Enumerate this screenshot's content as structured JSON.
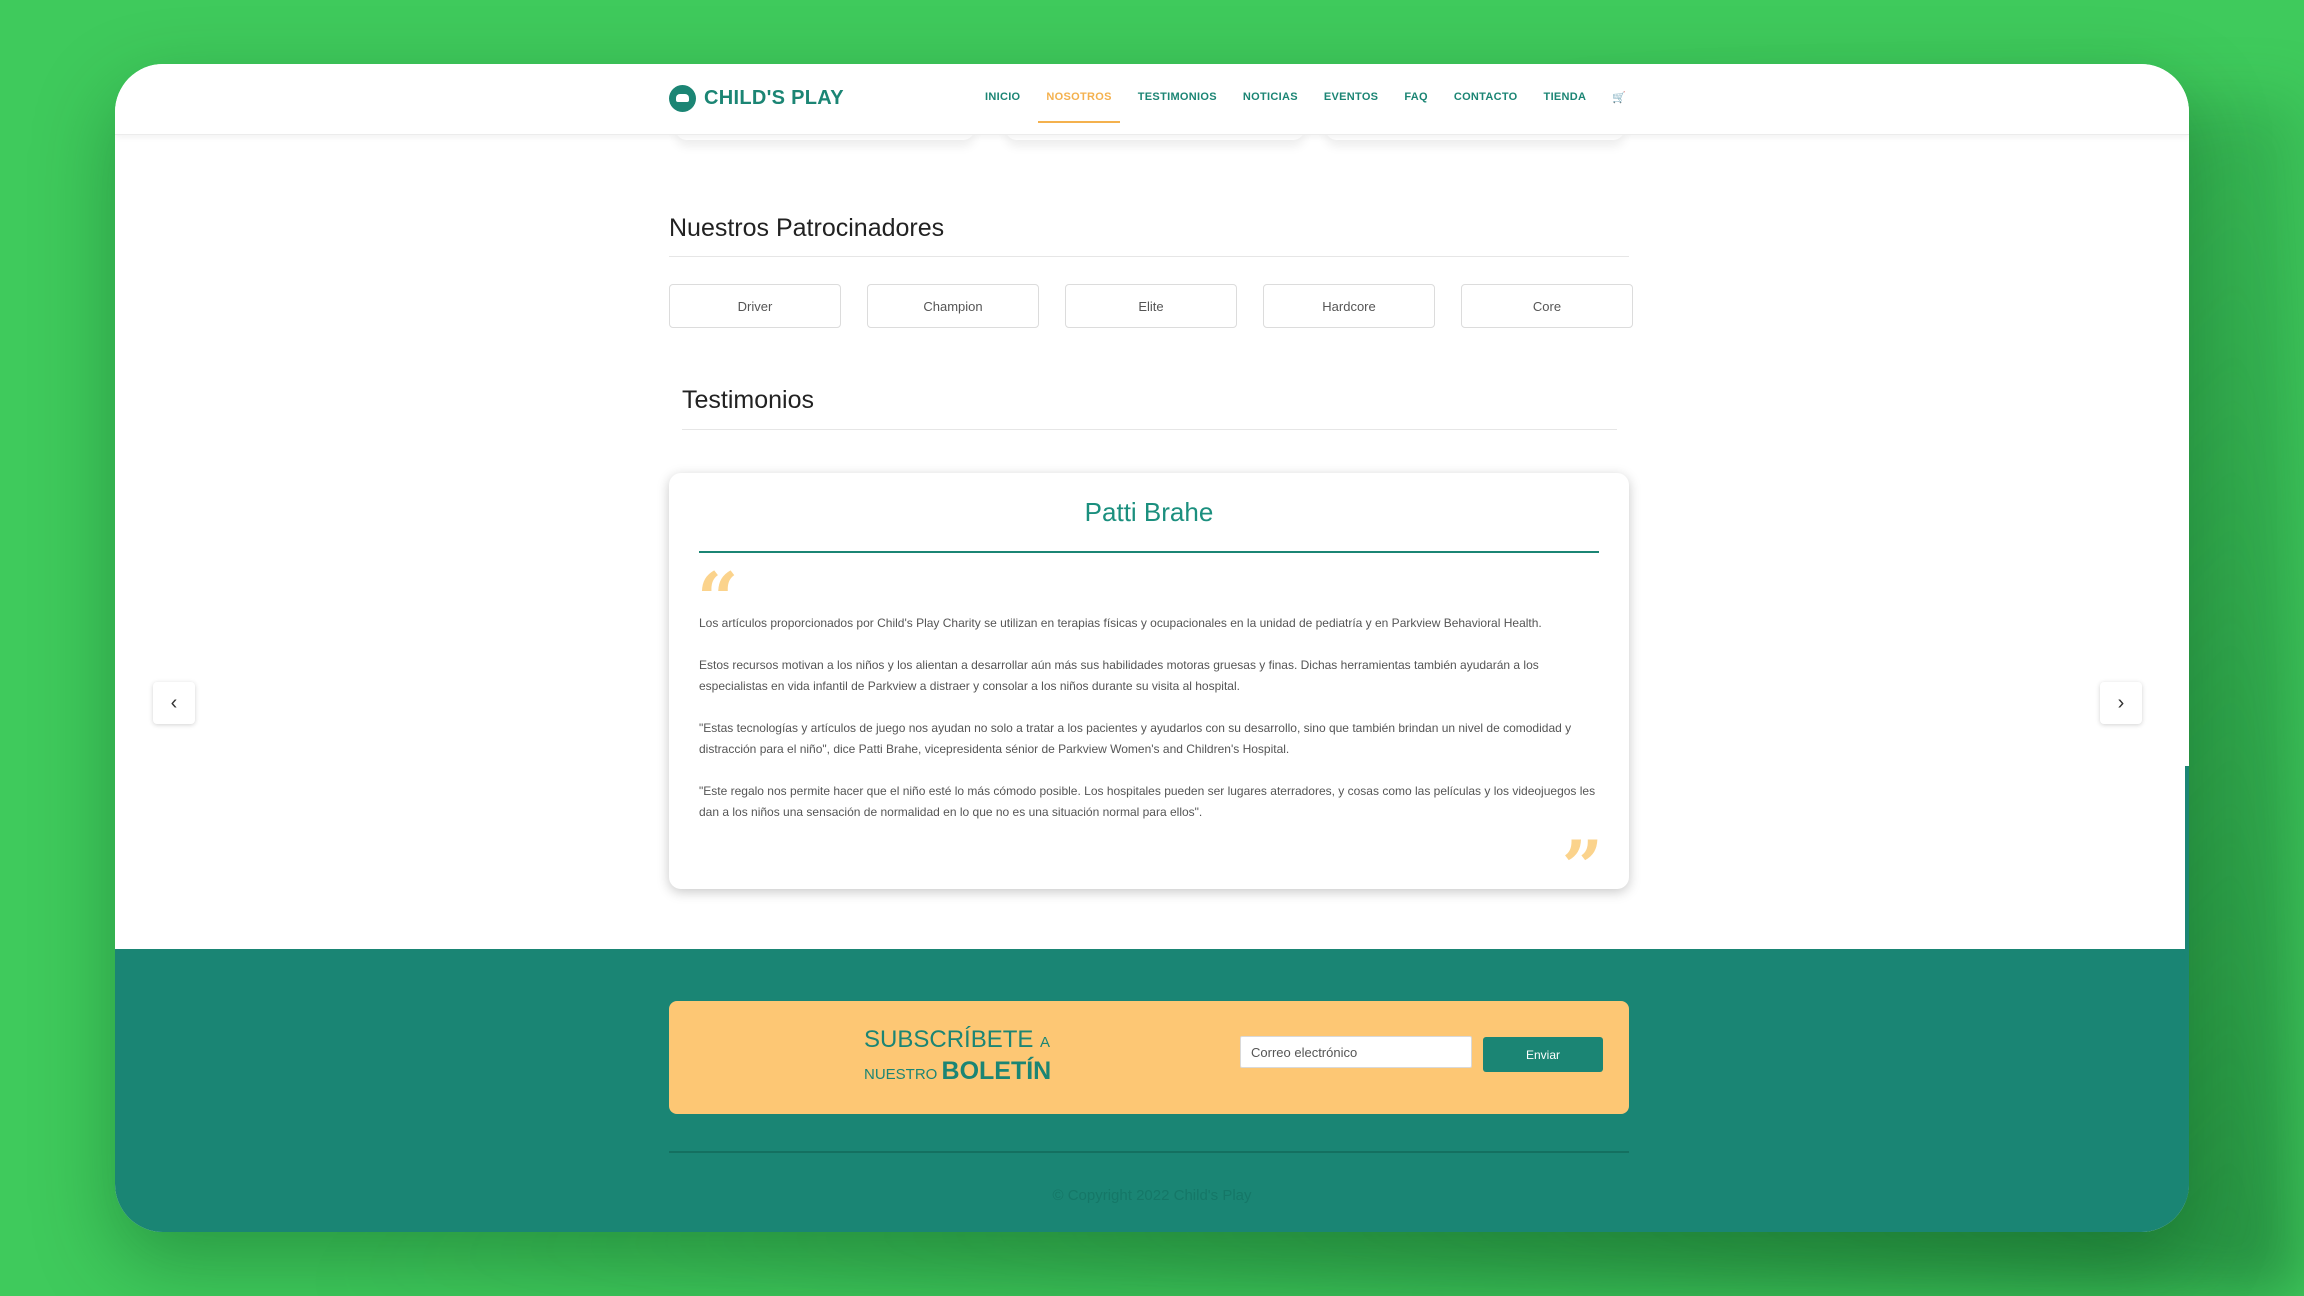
{
  "header": {
    "brand": "CHILD'S PLAY",
    "nav": [
      "INICIO",
      "NOSOTROS",
      "TESTIMONIOS",
      "NOTICIAS",
      "EVENTOS",
      "FAQ",
      "CONTACTO",
      "TIENDA"
    ],
    "active_nav": "NOSOTROS",
    "cart_icon": "🛒"
  },
  "sponsors": {
    "title": "Nuestros Patrocinadores",
    "tiers": [
      "Driver",
      "Champion",
      "Elite",
      "Hardcore",
      "Core"
    ]
  },
  "testimonials": {
    "title": "Testimonios",
    "name": "Patti Brahe",
    "paragraphs": [
      "Los artículos proporcionados por Child's Play Charity se utilizan en terapias físicas y ocupacionales en la unidad de pediatría y en Parkview Behavioral Health.",
      "Estos recursos motivan a los niños y los alientan a desarrollar aún más sus habilidades motoras gruesas y finas. Dichas herramientas también ayudarán a los especialistas en vida infantil de Parkview a distraer y consolar a los niños durante su visita al hospital.",
      "\"Estas tecnologías y artículos de juego nos ayudan no solo a tratar a los pacientes y ayudarlos con su desarrollo, sino que también brindan un nivel de comodidad y distracción para el niño\", dice Patti Brahe, vicepresidenta sénior de Parkview Women's and Children's Hospital.",
      "\"Este regalo nos permite hacer que el niño esté lo más cómodo posible. Los hospitales pueden ser lugares aterradores, y cosas como las películas y los videojuegos les dan a los niños una sensación de normalidad en lo que no es una situación normal para ellos\"."
    ],
    "prev_icon": "‹",
    "next_icon": "›"
  },
  "newsletter": {
    "line1_main": "SUBSCRÍBETE",
    "line1_small": "A",
    "line2_small": "NUESTRO",
    "line2_bold": "BOLETÍN",
    "email_placeholder": "Correo electrónico",
    "submit_label": "Enviar"
  },
  "footer": {
    "copyright": "© Copyright 2022 Child's Play"
  },
  "colors": {
    "primary": "#1b8574",
    "accent": "#f4b14e",
    "newsletter_bg": "#fdc774",
    "page_bg": "#3fca5c"
  }
}
